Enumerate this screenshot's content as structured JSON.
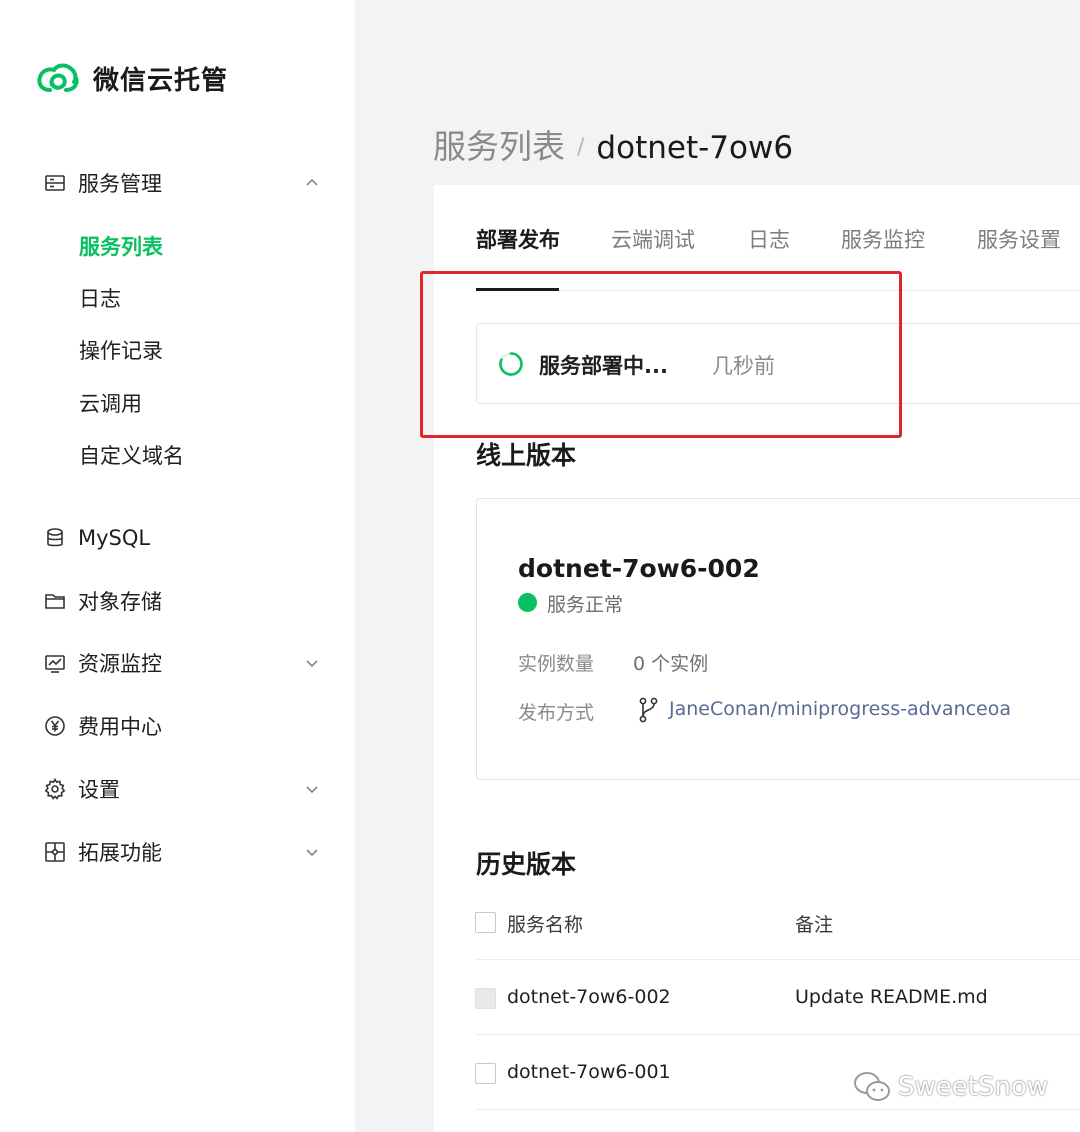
{
  "sidebar": {
    "app_title": "微信云托管",
    "service_management": {
      "label": "服务管理",
      "children": [
        "服务列表",
        "日志",
        "操作记录",
        "云调用",
        "自定义域名"
      ],
      "active_child": "服务列表"
    },
    "items": [
      {
        "label": "MySQL",
        "icon": "database-icon"
      },
      {
        "label": "对象存储",
        "icon": "folder-icon"
      },
      {
        "label": "资源监控",
        "icon": "monitor-chart-icon"
      },
      {
        "label": "费用中心",
        "icon": "yen-circle-icon"
      },
      {
        "label": "设置",
        "icon": "gear-icon"
      },
      {
        "label": "拓展功能",
        "icon": "extension-icon"
      }
    ]
  },
  "breadcrumb": {
    "parent": "服务列表",
    "separator": "/",
    "current": "dotnet-7ow6"
  },
  "tabs": [
    "部署发布",
    "云端调试",
    "日志",
    "服务监控",
    "服务设置"
  ],
  "active_tab": "部署发布",
  "deploy_status": {
    "text": "服务部署中...",
    "time": "几秒前"
  },
  "online_version": {
    "section_title": "线上版本",
    "name": "dotnet-7ow6-002",
    "status": "服务正常",
    "instances_label": "实例数量",
    "instances_value": "0 个实例",
    "publish_label": "发布方式",
    "publish_value": "JaneConan/miniprogress-advanceoa"
  },
  "history": {
    "section_title": "历史版本",
    "columns": [
      "服务名称",
      "备注"
    ],
    "rows": [
      {
        "name": "dotnet-7ow6-002",
        "note": "Update README.md"
      },
      {
        "name": "dotnet-7ow6-001",
        "note": ""
      }
    ]
  },
  "watermark": "SweetSnow",
  "colors": {
    "brand_green": "#07c160",
    "highlight_red": "#e0262d",
    "link": "#576b95"
  }
}
